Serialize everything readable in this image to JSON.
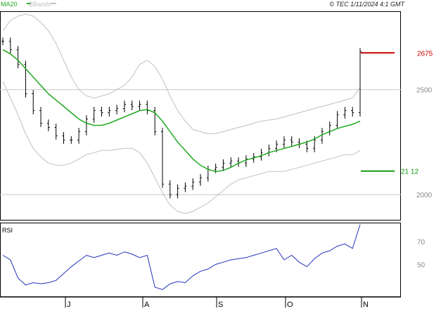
{
  "header": {
    "legend_ma": "MA20",
    "legend_bb": "BBands",
    "copyright": "© TEC 1/11/2024 4:1 GMT"
  },
  "colors": {
    "ma": "#22aa22",
    "bands": "#c0c0c0",
    "bars": "#000000",
    "rsi": "#2233bb",
    "resistance": "#cc0000",
    "support": "#119911",
    "grid": "#c8c8c8"
  },
  "chart_data": [
    {
      "type": "ohlc",
      "title": "",
      "x_labels": [
        "J",
        "A",
        "S",
        "O",
        "N"
      ],
      "y_ticks": [
        2000,
        2500
      ],
      "ylim": [
        1880,
        2870
      ],
      "grid": true,
      "levels": [
        {
          "name": "resistance",
          "value": 2675,
          "label": "2675"
        },
        {
          "name": "support",
          "value": 2112,
          "label": "21 12"
        }
      ],
      "series": [
        {
          "name": "MA20",
          "values": [
            2690,
            2670,
            2640,
            2600,
            2560,
            2520,
            2480,
            2450,
            2420,
            2390,
            2360,
            2340,
            2330,
            2330,
            2340,
            2355,
            2370,
            2385,
            2400,
            2405,
            2390,
            2350,
            2300,
            2250,
            2210,
            2170,
            2140,
            2120,
            2110,
            2115,
            2130,
            2150,
            2165,
            2175,
            2185,
            2200,
            2210,
            2220,
            2230,
            2240,
            2250,
            2265,
            2285,
            2300,
            2315,
            2325,
            2335,
            2350
          ]
        },
        {
          "name": "Upper band",
          "values": [
            2780,
            2830,
            2850,
            2860,
            2850,
            2820,
            2780,
            2720,
            2640,
            2560,
            2500,
            2470,
            2460,
            2470,
            2480,
            2500,
            2520,
            2560,
            2620,
            2640,
            2610,
            2550,
            2470,
            2400,
            2350,
            2310,
            2300,
            2290,
            2290,
            2300,
            2310,
            2320,
            2330,
            2340,
            2350,
            2355,
            2360,
            2370,
            2380,
            2390,
            2400,
            2410,
            2420,
            2430,
            2440,
            2450,
            2460,
            2510
          ]
        },
        {
          "name": "Lower band",
          "values": [
            2540,
            2460,
            2380,
            2290,
            2220,
            2180,
            2150,
            2140,
            2140,
            2150,
            2170,
            2190,
            2200,
            2210,
            2210,
            2215,
            2220,
            2220,
            2200,
            2150,
            2080,
            2010,
            1950,
            1920,
            1910,
            1920,
            1940,
            1960,
            1990,
            2020,
            2050,
            2070,
            2080,
            2090,
            2100,
            2110,
            2110,
            2110,
            2120,
            2130,
            2140,
            2150,
            2160,
            2170,
            2180,
            2190,
            2190,
            2210
          ]
        },
        {
          "name": "Close",
          "values": [
            2730,
            2690,
            2620,
            2480,
            2400,
            2340,
            2320,
            2280,
            2260,
            2260,
            2300,
            2360,
            2400,
            2390,
            2400,
            2410,
            2430,
            2420,
            2430,
            2400,
            2300,
            2050,
            2000,
            2030,
            2040,
            2060,
            2080,
            2120,
            2130,
            2150,
            2160,
            2150,
            2170,
            2180,
            2200,
            2220,
            2240,
            2260,
            2250,
            2240,
            2220,
            2260,
            2300,
            2330,
            2380,
            2400,
            2390,
            2680
          ]
        }
      ]
    },
    {
      "type": "line",
      "title": "RSI",
      "x_labels": [
        "J",
        "A",
        "S",
        "O",
        "N"
      ],
      "y_ticks": [
        50,
        70
      ],
      "ylim": [
        22,
        86
      ],
      "grid": false,
      "series": [
        {
          "name": "RSI",
          "values": [
            58,
            54,
            38,
            32,
            34,
            33,
            34,
            36,
            42,
            48,
            53,
            58,
            56,
            58,
            60,
            58,
            61,
            59,
            56,
            58,
            30,
            28,
            33,
            35,
            34,
            40,
            44,
            46,
            50,
            52,
            54,
            55,
            56,
            58,
            60,
            62,
            64,
            54,
            58,
            52,
            48,
            55,
            60,
            62,
            66,
            68,
            64,
            85
          ]
        }
      ]
    }
  ]
}
